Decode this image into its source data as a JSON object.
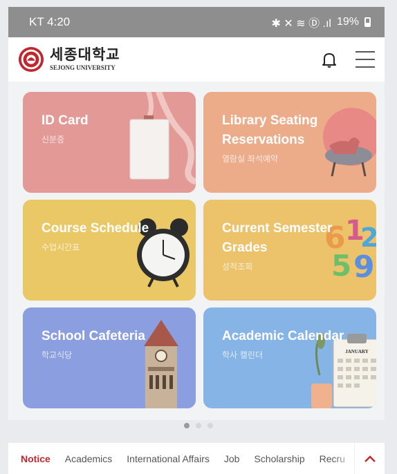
{
  "status_bar": {
    "carrier_time": "KT 4:20",
    "indicators": "✱ ✕ ≋ Ⓓ .ıl",
    "battery": "19%"
  },
  "header": {
    "logo_ko": "세종대학교",
    "logo_en": "SEJONG UNIVERSITY",
    "icons": [
      "bell-icon",
      "hamburger-menu-icon"
    ]
  },
  "cards": [
    {
      "title": "ID Card",
      "subtitle": "신분증",
      "color": "#e39a96",
      "icon": "id-badge-lanyard"
    },
    {
      "title": "Library Seating Reservations",
      "subtitle": "열람실 좌석예약",
      "color": "#ecac8a",
      "icon": "armchair"
    },
    {
      "title": "Course Schedule",
      "subtitle": "수업시간표",
      "color": "#ebc866",
      "icon": "alarm-clock"
    },
    {
      "title": "Current Semester Grades",
      "subtitle": "성적조회",
      "color": "#ecc26b",
      "icon": "colorful-numbers"
    },
    {
      "title": "School Cafeteria",
      "subtitle": "학교식당",
      "color": "#8a9ee0",
      "icon": "clock-tower"
    },
    {
      "title": "Academic Calendar",
      "subtitle": "학사 캘린더",
      "color": "#86b4e6",
      "icon": "calendar-clipboard"
    }
  ],
  "calendar_prop_text": "JANUARY",
  "pagination": {
    "pages": 3,
    "active": 1
  },
  "bottom_tabs": [
    "Notice",
    "Academics",
    "International Affairs",
    "Job",
    "Scholarship",
    "Recru"
  ],
  "active_tab": "Notice",
  "accent_color": "#c0282e"
}
